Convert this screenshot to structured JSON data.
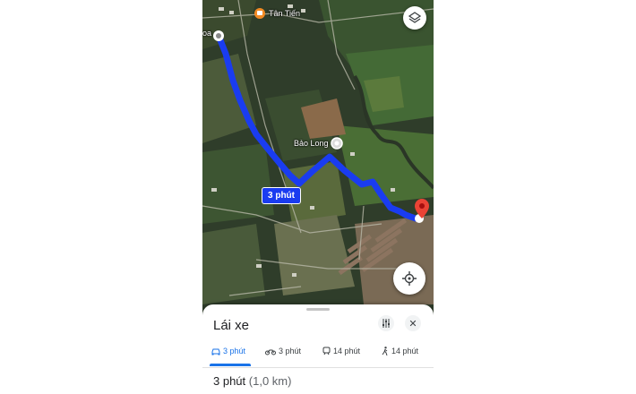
{
  "map": {
    "place_top": "Tân Tiến",
    "place_left_partial": "oa",
    "place_middle": "Bảo Long",
    "route_time_badge": "3 phút"
  },
  "icons": {
    "layers": "layers-icon",
    "locate": "my-location-icon",
    "destination": "red-pin-icon",
    "origin": "origin-dot-icon"
  },
  "sheet": {
    "title": "Lái xe",
    "modes": [
      {
        "label": "3 phút",
        "icon": "car-icon",
        "active": true
      },
      {
        "label": "3 phút",
        "icon": "motorbike-icon",
        "active": false
      },
      {
        "label": "14 phút",
        "icon": "transit-icon",
        "active": false
      },
      {
        "label": "14 phút",
        "icon": "walk-icon",
        "active": false
      }
    ],
    "summary_time": "3 phút",
    "summary_distance": "(1,0 km)"
  },
  "colors": {
    "route": "#1a3cf0",
    "accent": "#1a73e8",
    "pin": "#ea4335"
  }
}
